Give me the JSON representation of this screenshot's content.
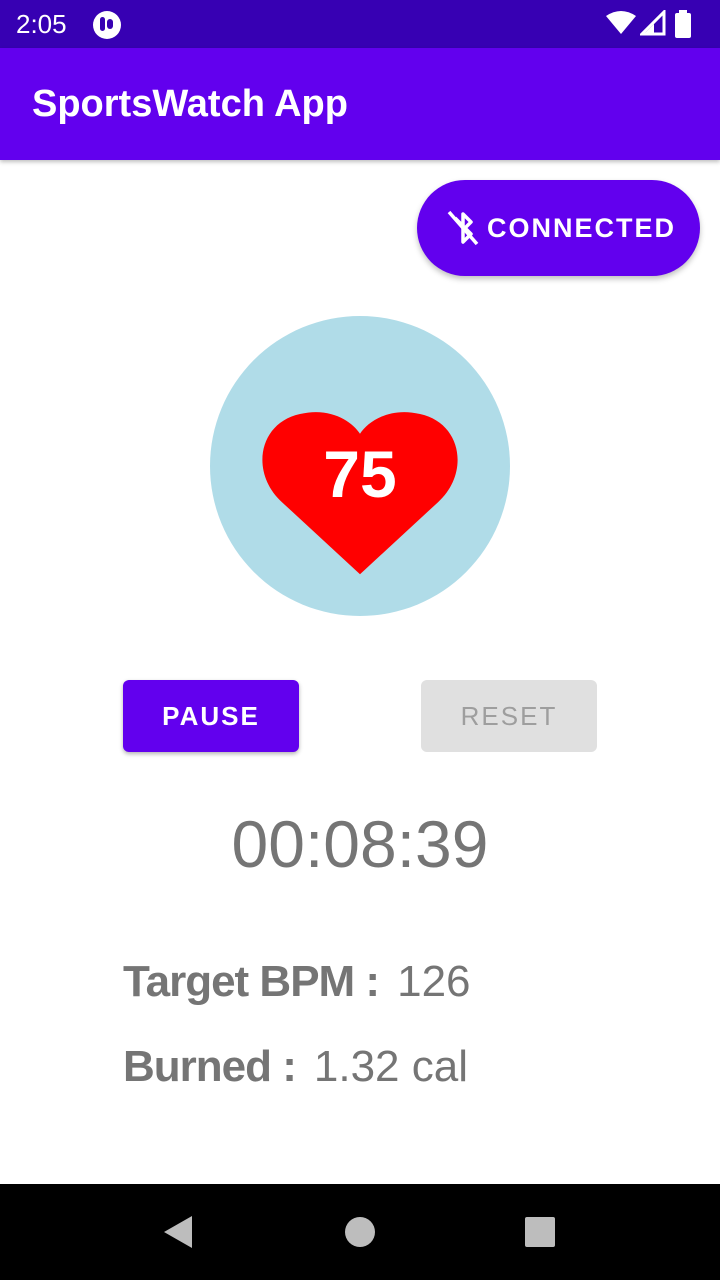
{
  "status_bar": {
    "time": "2:05"
  },
  "app_bar": {
    "title": "SportsWatch App"
  },
  "connection": {
    "label": "CONNECTED",
    "icon": "bluetooth-disabled-icon"
  },
  "heart_rate": {
    "value": "75",
    "icon": "heart-icon"
  },
  "controls": {
    "pause_label": "PAUSE",
    "reset_label": "RESET"
  },
  "timer": {
    "elapsed": "00:08:39"
  },
  "stats": {
    "target_label": "Target BPM :",
    "target_value": "126",
    "burned_label": "Burned :",
    "burned_value": "1.32 cal"
  },
  "colors": {
    "primary": "#6200ee",
    "primary_dark": "#3700b3",
    "circle": "#b0dce8",
    "heart": "#ff0000",
    "text_gray": "#757575"
  }
}
